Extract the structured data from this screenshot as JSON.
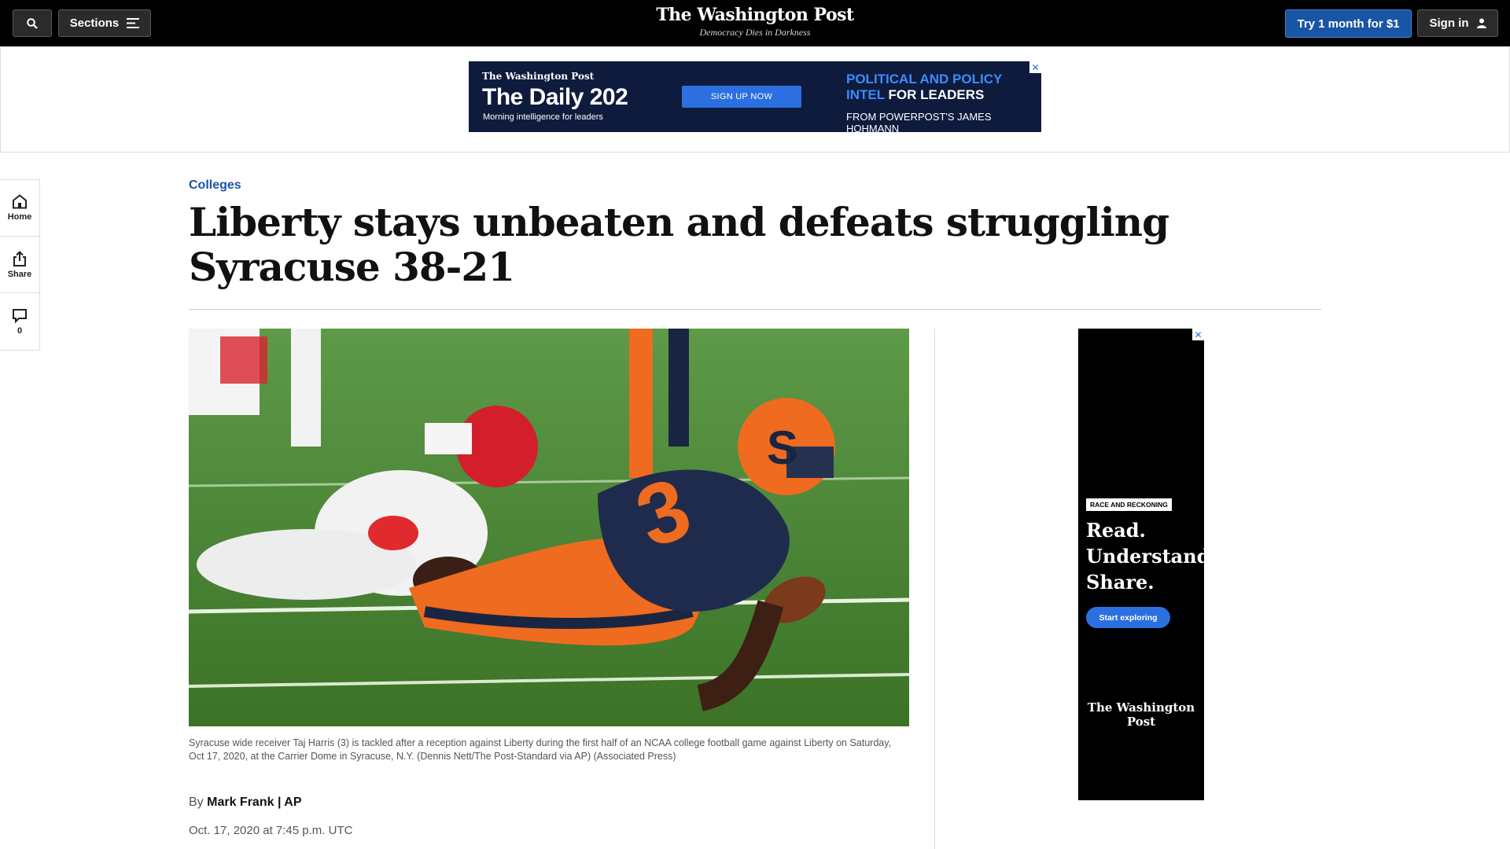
{
  "nav": {
    "sections_label": "Sections",
    "logo_name": "The Washington Post",
    "logo_tagline": "Democracy Dies in Darkness",
    "try_label": "Try 1 month for $1",
    "signin_label": "Sign in"
  },
  "top_ad": {
    "logo": "The Washington Post",
    "title": "The Daily 202",
    "subtitle": "Morning intelligence for leaders",
    "cta": "SIGN UP NOW",
    "right_blue": "POLITICAL AND POLICY INTEL",
    "right_white": "FOR LEADERS",
    "right_bottom": "FROM POWERPOST'S JAMES HOHMANN",
    "close": "✕"
  },
  "rail": {
    "home": "Home",
    "share": "Share",
    "comments": "0"
  },
  "article": {
    "kicker": "Colleges",
    "headline": "Liberty stays unbeaten and defeats struggling Syracuse 38-21",
    "caption": "Syracuse wide receiver Taj Harris (3) is tackled after a reception against Liberty during the first half of an NCAA college football game against Liberty on Saturday, Oct 17, 2020, at the Carrier Dome in Syracuse, N.Y. (Dennis Nett/The Post-Standard via AP) (Associated Press)",
    "by": "By",
    "author": "Mark Frank | AP",
    "date": "Oct. 17, 2020 at 7:45 p.m. UTC"
  },
  "side_ad": {
    "tag": "RACE AND RECKONING",
    "line1": "Read.",
    "line2": "Understand.",
    "line3": "Share.",
    "cta": "Start exploring",
    "logo": "The Washington Post",
    "close": "✕"
  },
  "icons": [
    "search-icon",
    "menu-icon",
    "user-icon",
    "home-icon",
    "share-icon",
    "comment-icon",
    "close-icon"
  ]
}
